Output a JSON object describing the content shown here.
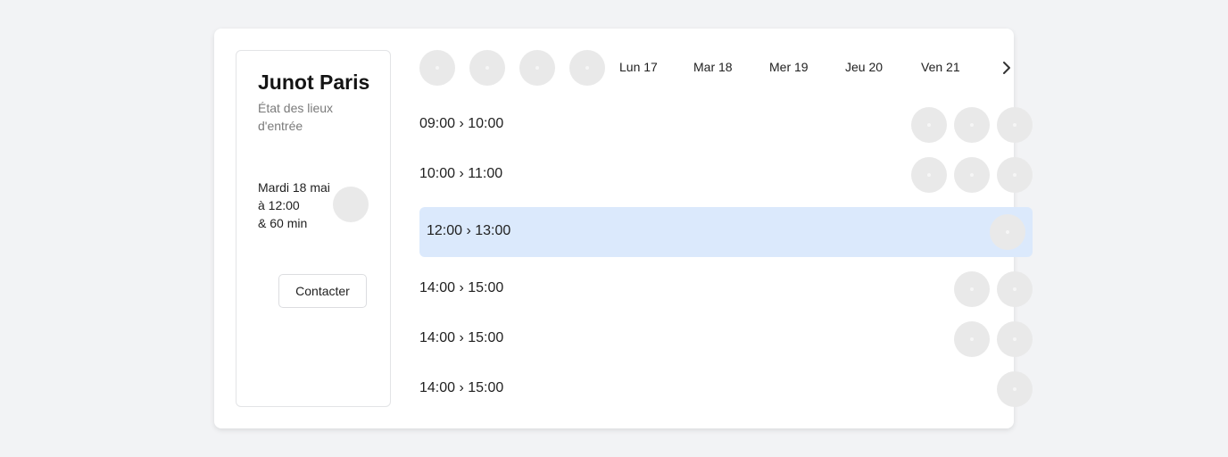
{
  "sidebar": {
    "title": "Junot Paris",
    "subtitle": "État des lieux d'entrée",
    "when_lines": [
      "Mardi 18 mai",
      "à 12:00",
      "& 60 min"
    ],
    "contact_label": "Contacter"
  },
  "calendar": {
    "days": [
      "Lun 17",
      "Mar 18",
      "Mer 19",
      "Jeu 20",
      "Ven 21"
    ],
    "next_icon": "chevron-right-icon"
  },
  "slots": [
    {
      "label": "09:00 › 10:00",
      "avatars": 3,
      "selected": false
    },
    {
      "label": "10:00 › 11:00",
      "avatars": 3,
      "selected": false
    },
    {
      "label": "12:00 › 13:00",
      "avatars": 1,
      "selected": true
    },
    {
      "label": "14:00 › 15:00",
      "avatars": 2,
      "selected": false
    },
    {
      "label": "14:00 › 15:00",
      "avatars": 2,
      "selected": false
    },
    {
      "label": "14:00 › 15:00",
      "avatars": 1,
      "selected": false
    }
  ],
  "colors": {
    "page_bg": "#f2f3f5",
    "selected_bg": "#dbe9fc",
    "avatar_placeholder": "#e9e9e9"
  }
}
